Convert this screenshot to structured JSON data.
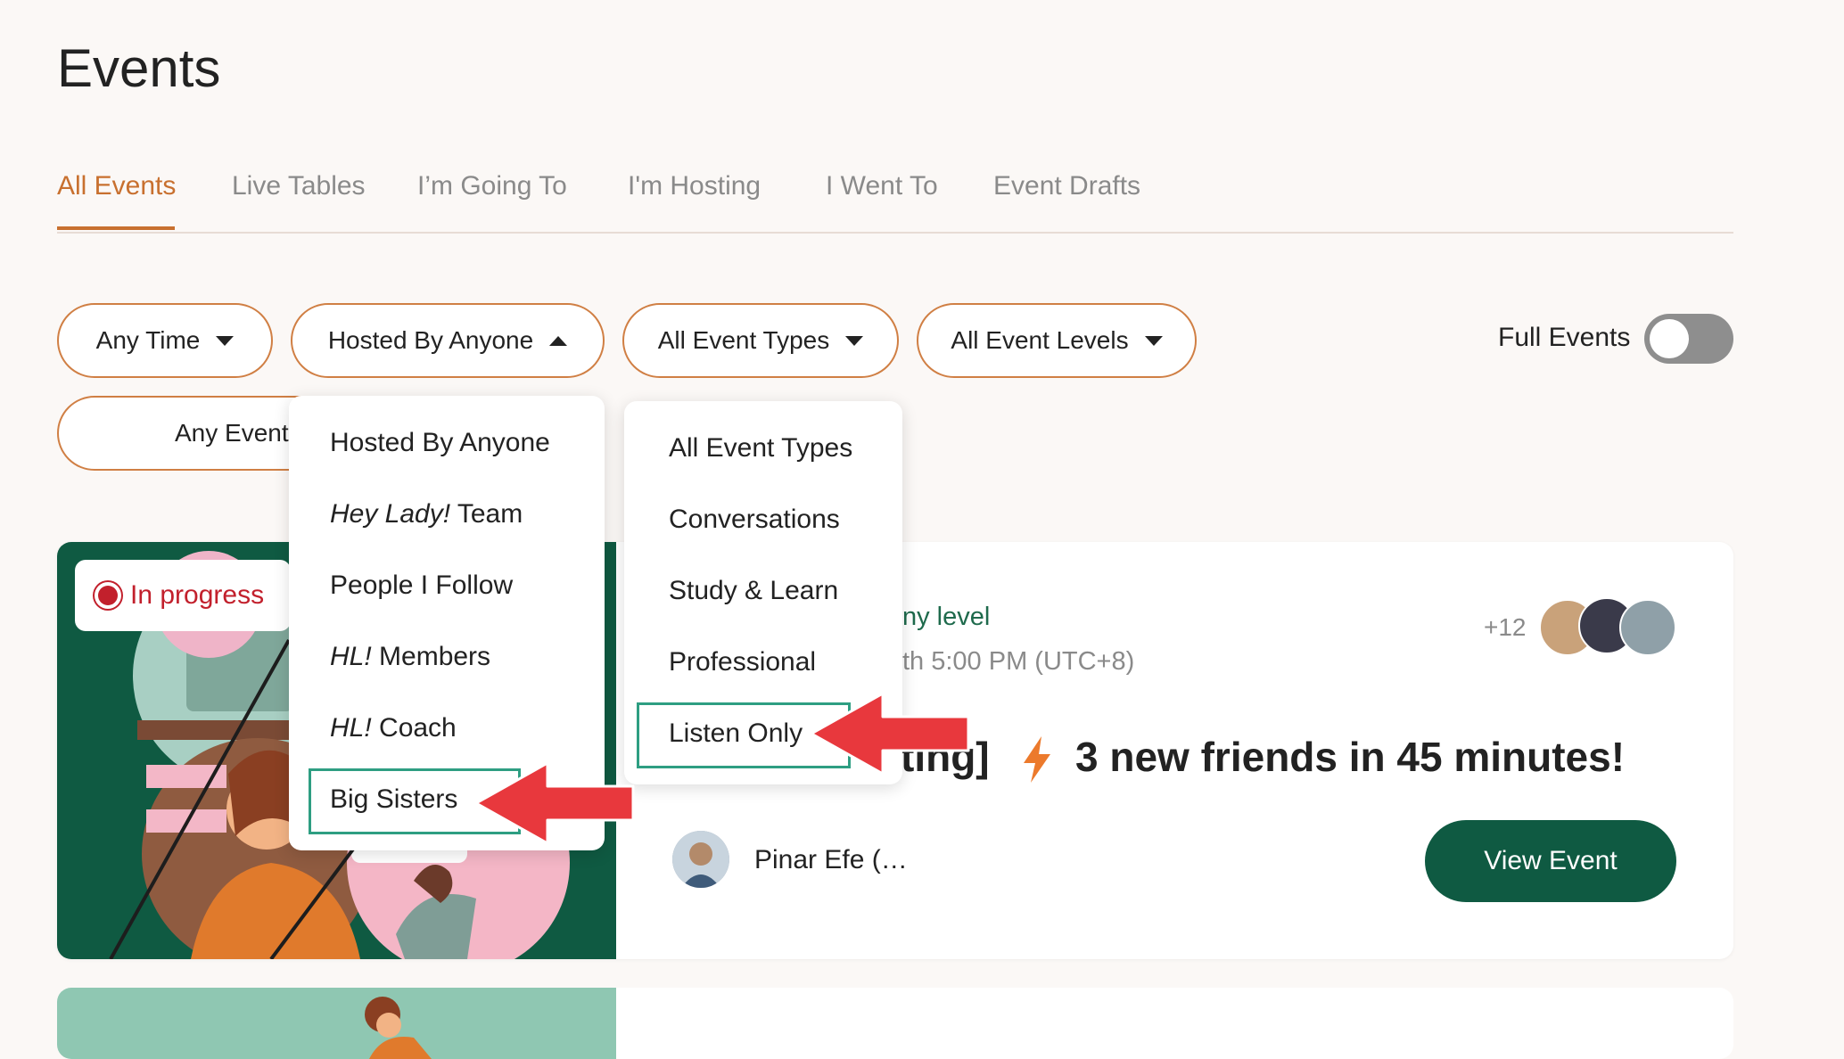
{
  "page": {
    "title": "Events"
  },
  "tabs": [
    {
      "label": "All Events",
      "active": true
    },
    {
      "label": "Live Tables"
    },
    {
      "label": "I’m Going To"
    },
    {
      "label": "I'm Hosting"
    },
    {
      "label": "I Went To"
    },
    {
      "label": "Event Drafts"
    }
  ],
  "filters": {
    "time": "Any Time",
    "host": "Hosted By Anyone",
    "type": "All Event Types",
    "level": "All Event Levels",
    "duration": "Any Event D",
    "full_events_label": "Full Events",
    "full_events_on": false
  },
  "host_menu": {
    "items": [
      {
        "label": "Hosted By Anyone"
      },
      {
        "em": "Hey Lady!",
        "rest": " Team"
      },
      {
        "label": "People I Follow"
      },
      {
        "em": "HL!",
        "rest": " Members"
      },
      {
        "em": "HL!",
        "rest": " Coach"
      },
      {
        "label": "Big Sisters",
        "highlighted": true
      }
    ]
  },
  "type_menu": {
    "items": [
      {
        "label": "All Event Types"
      },
      {
        "label": "Conversations"
      },
      {
        "label": "Study & Learn"
      },
      {
        "label": "Professional"
      },
      {
        "label": "Listen Only",
        "highlighted": true
      }
    ]
  },
  "event_card": {
    "status": "In progress",
    "level_fragment": "ny level",
    "time_fragment": "th 5:00 PM (UTC+8)",
    "attendee_extra": "+12",
    "title_fragment": "ting]",
    "title_main": "3 new friends in 45 minutes!",
    "host_name": "Pinar Efe (…",
    "cta": "View Event"
  },
  "colors": {
    "accent": "#c8702f",
    "brand_green": "#0f5a42",
    "highlight_box": "#2e9e82",
    "annotation_arrow": "#e8383d",
    "status_red": "#c2202c"
  }
}
